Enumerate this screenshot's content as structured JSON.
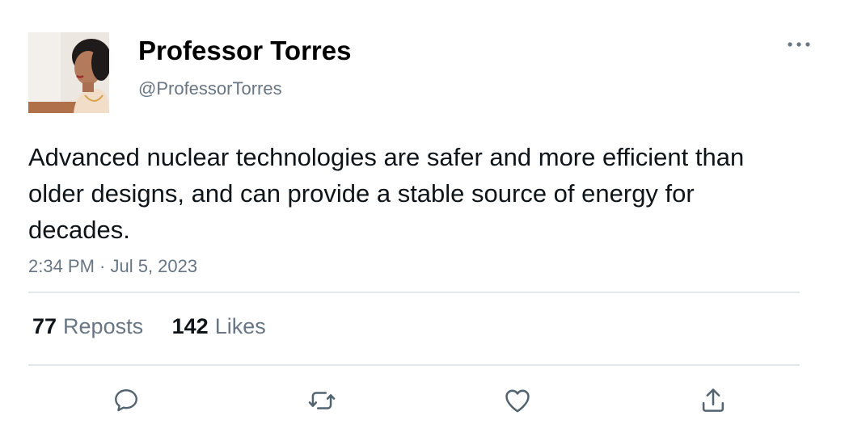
{
  "author": {
    "name": "Professor Torres",
    "handle": "@ProfessorTorres"
  },
  "tweet": {
    "text": "Advanced nuclear technologies are safer and more efficient than older designs, and can provide a stable source of energy for decades.",
    "timestamp": "2:34 PM · Jul 5, 2023"
  },
  "stats": {
    "reposts_count": "77",
    "reposts_label": "Reposts",
    "likes_count": "142",
    "likes_label": "Likes"
  },
  "actions": [
    "reply-icon",
    "repost-icon",
    "like-icon",
    "share-icon"
  ],
  "colors": {
    "text": "#0f1419",
    "secondary": "#687684",
    "divider": "#e3e6ea"
  }
}
